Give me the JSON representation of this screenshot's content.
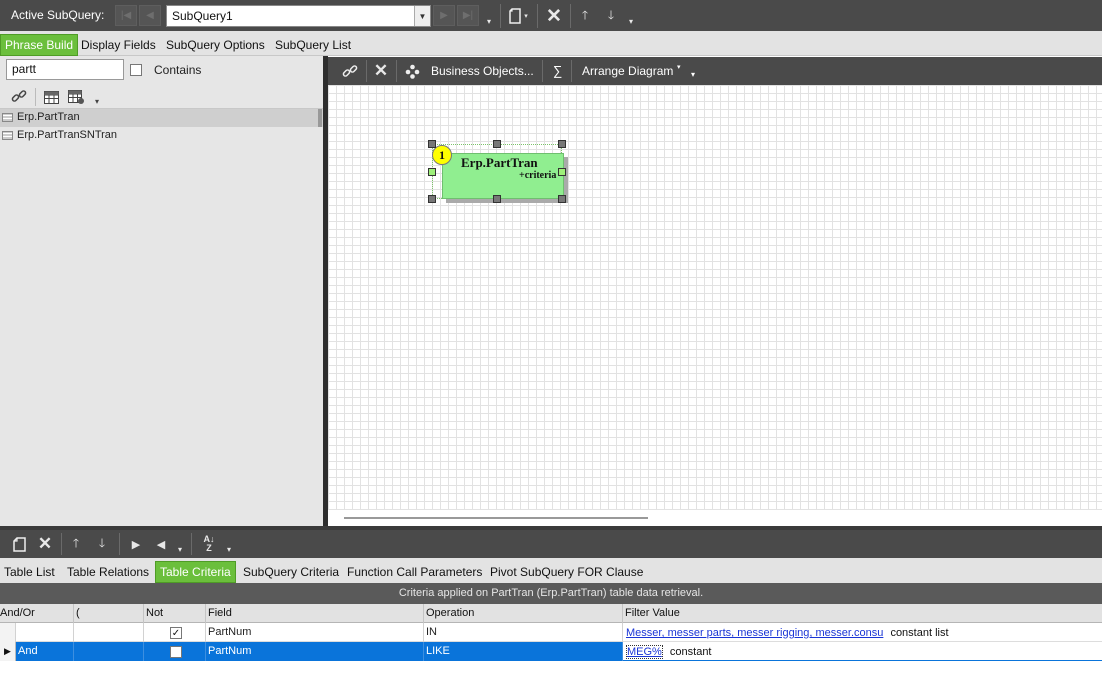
{
  "topbar": {
    "active_subquery_label": "Active SubQuery:",
    "subquery_value": "SubQuery1"
  },
  "main_tabs": [
    "Phrase Build",
    "Display Fields",
    "SubQuery Options",
    "SubQuery List"
  ],
  "left": {
    "search_value": "partt",
    "contains_label": "Contains",
    "tables": [
      "Erp.PartTran",
      "Erp.PartTranSNTran"
    ]
  },
  "diagram_toolbar": {
    "business_objects_label": "Business Objects...",
    "sigma_label": "∑",
    "arrange_label": "Arrange Diagram"
  },
  "diagram": {
    "node_badge": "1",
    "node_title": "Erp.PartTran",
    "node_sub": "+criteria"
  },
  "bottom_tabs": [
    "Table List",
    "Table Relations",
    "Table Criteria",
    "SubQuery Criteria",
    "Function Call Parameters",
    "Pivot SubQuery FOR Clause"
  ],
  "criteria_caption": "Criteria applied on PartTran (Erp.PartTran) table data retrieval.",
  "grid": {
    "headers": [
      "And/Or",
      "(",
      "Not",
      "Field",
      "Operation",
      "Filter Value"
    ],
    "rows": [
      {
        "andor": "",
        "paren": "",
        "not": "✓",
        "field": "PartNum",
        "operation": "IN",
        "filter_link": "Messer, messer parts, messer rigging, messer.consu",
        "filter_type": "constant list"
      },
      {
        "andor": "And",
        "paren": "",
        "not": "",
        "field": "PartNum",
        "operation": "LIKE",
        "filter_link": "MEG%",
        "filter_type": "constant"
      }
    ]
  },
  "colors": {
    "accent_green": "#6bbf3c",
    "node_fill": "#90ee90",
    "selection_blue": "#0a74da",
    "toolbar_dark": "#4a4a4a"
  }
}
